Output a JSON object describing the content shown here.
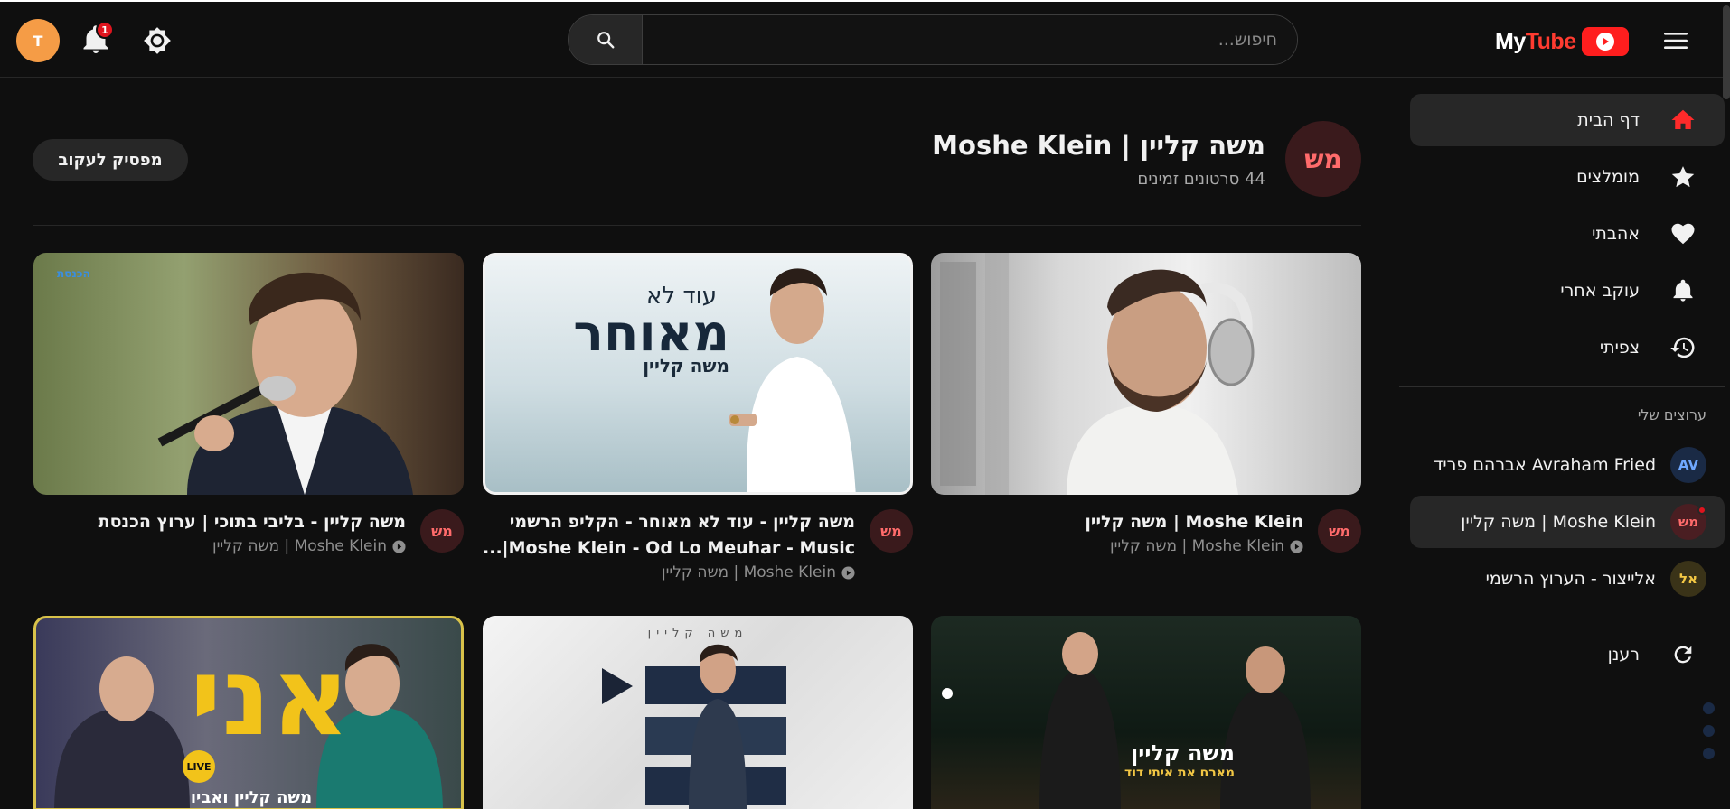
{
  "header": {
    "user_initial": "T",
    "notification_count": "1",
    "search_placeholder": "חיפוש...",
    "logo_my": "My",
    "logo_tube": "Tube"
  },
  "sidebar": {
    "nav": [
      {
        "label": "דף הבית",
        "icon": "home-icon"
      },
      {
        "label": "מומלצים",
        "icon": "star-icon"
      },
      {
        "label": "אהבתי",
        "icon": "heart-icon"
      },
      {
        "label": "עוקב אחרי",
        "icon": "bell-icon"
      },
      {
        "label": "צפיתי",
        "icon": "history-icon"
      }
    ],
    "channels_heading": "ערוצים שלי",
    "channels": [
      {
        "initials": "AV",
        "label": "Avraham Fried אברהם פריד"
      },
      {
        "initials": "מש",
        "label": "Moshe Klein | משה קליין"
      },
      {
        "initials": "אל",
        "label": "אלייצור - הערוץ הרשמי"
      }
    ],
    "refresh_label": "רענן"
  },
  "channel": {
    "initials": "מש",
    "title": "משה קליין | Moshe Klein",
    "video_count": "44 סרטונים זמינים",
    "unfollow_label": "מפסיק לעקוב"
  },
  "videos": [
    {
      "title": "Moshe Klein | משה קליין",
      "channel": "Moshe Klein | משה קליין",
      "initials": "מש"
    },
    {
      "title": "משה קליין - עוד לא מאוחר - הקליפ הרשמי Moshe Klein - Od Lo Meuhar - Music|...",
      "channel": "Moshe Klein | משה קליין",
      "initials": "מש"
    },
    {
      "title": "משה קליין - בליבי בתוכי | ערוץ הכנסת",
      "channel": "Moshe Klein | משה קליין",
      "initials": "מש"
    }
  ],
  "thumbnail_text": {
    "t2_line1": "עוד לא",
    "t2_line2": "מאוחר",
    "t2_line3": "משה קליין",
    "t3_logo": "הכנסת",
    "t4_name": "משה קליין",
    "t4_sub": "מארח את איתי דוד",
    "t5_top": "משה קליין",
    "t6_big": "אני",
    "t6_live": "LIVE",
    "t6_names": "משה קליין ואביו"
  },
  "colors": {
    "accent_red": "#ff1e1e",
    "background": "#0f0f0f",
    "badge_red": "#e0141e"
  }
}
